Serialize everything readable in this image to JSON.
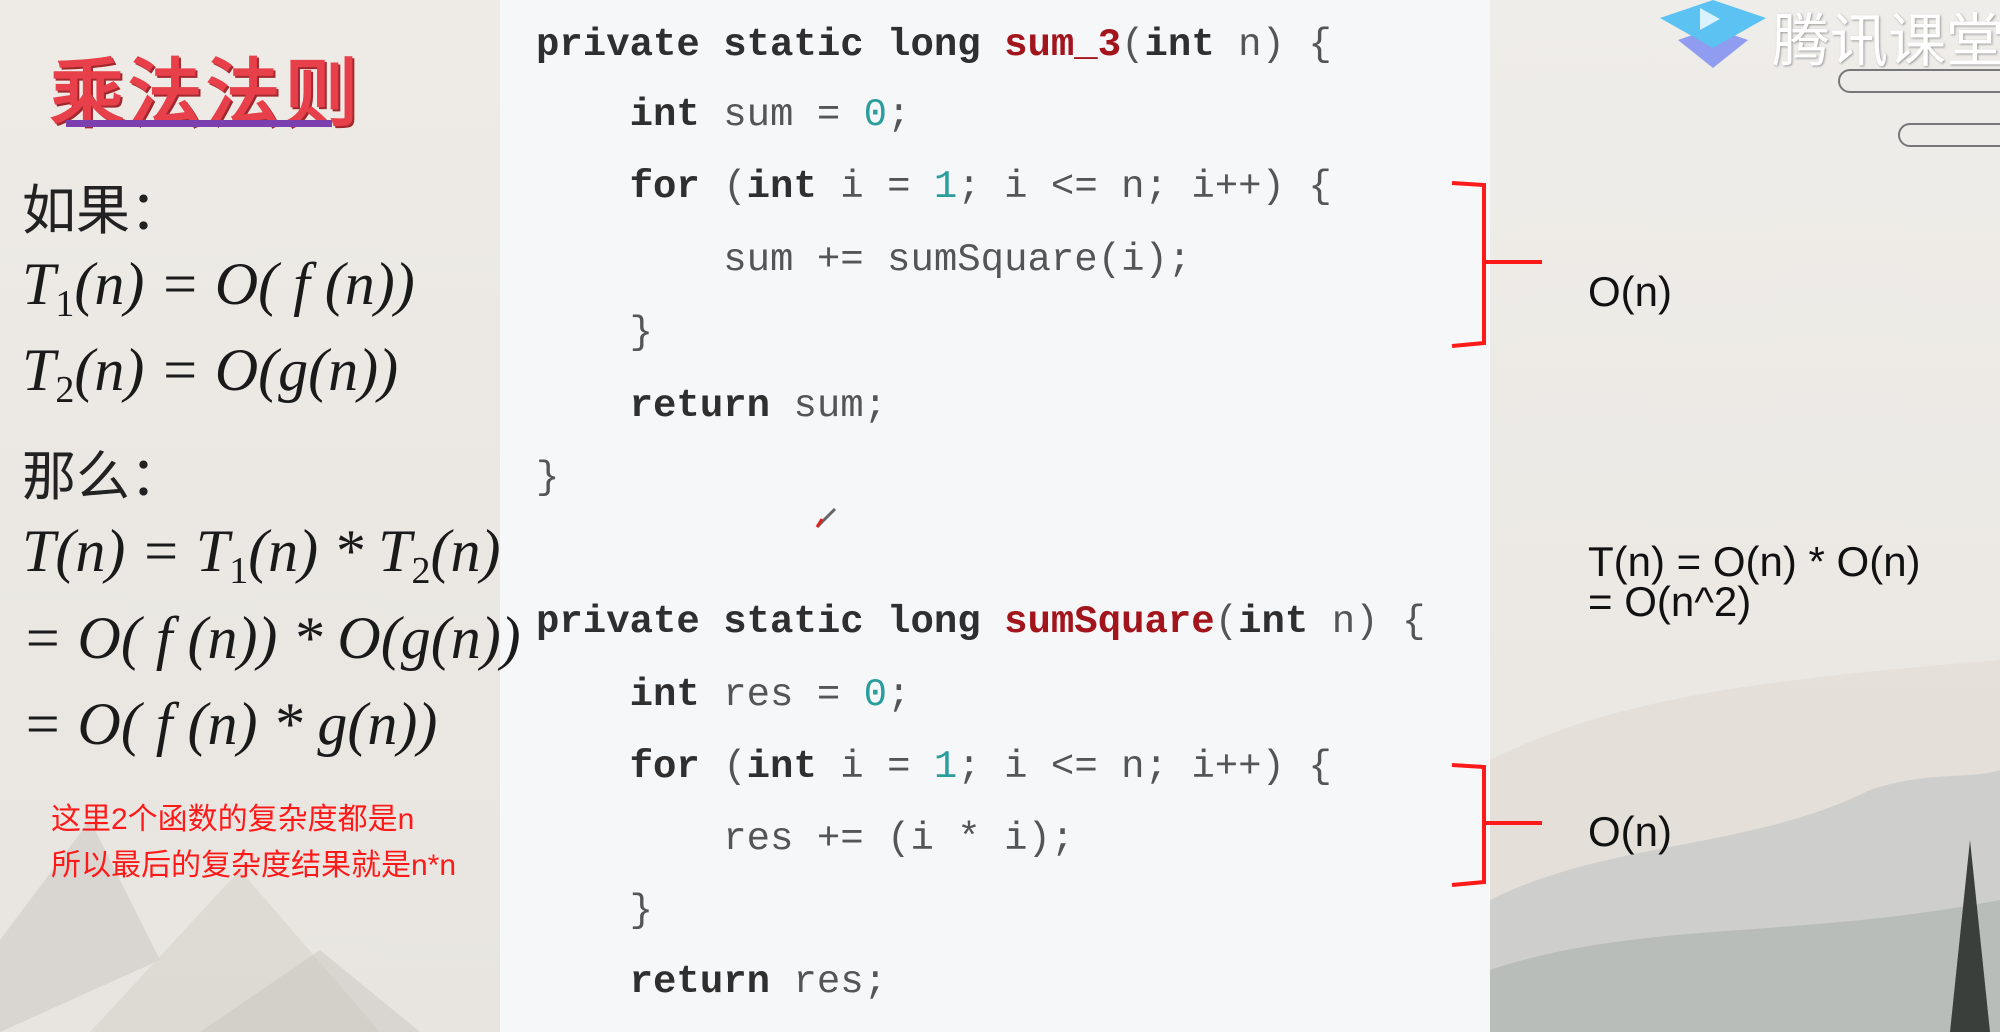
{
  "slide": {
    "title": "乘法法则",
    "if_label": "如果：",
    "then_label": "那么：",
    "math_lines": [
      [
        {
          "t": "T"
        },
        {
          "sub": "1"
        },
        {
          "t": "(n) = O( f (n))"
        }
      ],
      [
        {
          "t": "T"
        },
        {
          "sub": "2"
        },
        {
          "t": "(n) = O(g(n))"
        }
      ],
      [
        {
          "t": "T(n) = T"
        },
        {
          "sub": "1"
        },
        {
          "t": "(n) * T"
        },
        {
          "sub": "2"
        },
        {
          "t": "(n)"
        }
      ],
      [
        {
          "t": "= O( f (n)) * O(g(n))"
        }
      ],
      [
        {
          "t": "= O( f (n) * g(n))"
        }
      ]
    ],
    "note_lines": [
      "这里2个函数的复杂度都是n",
      "所以最后的复杂度结果就是n*n"
    ]
  },
  "code": [
    [
      {
        "t": "private static long ",
        "c": "kw"
      },
      {
        "t": "sum_3",
        "c": "fn"
      },
      {
        "t": "(",
        "c": ""
      },
      {
        "t": "int",
        "c": "kw"
      },
      {
        "t": " n) {",
        "c": ""
      }
    ],
    [
      {
        "t": "    "
      },
      {
        "t": "int",
        "c": "kw"
      },
      {
        "t": " sum = "
      },
      {
        "t": "0",
        "c": "num"
      },
      {
        "t": ";"
      }
    ],
    [
      {
        "t": "    "
      },
      {
        "t": "for",
        "c": "kw"
      },
      {
        "t": " ("
      },
      {
        "t": "int",
        "c": "kw"
      },
      {
        "t": " i = "
      },
      {
        "t": "1",
        "c": "num"
      },
      {
        "t": "; i <= n; i++) {"
      }
    ],
    [
      {
        "t": "        sum += sumSquare(i);"
      }
    ],
    [
      {
        "t": "    }"
      }
    ],
    [
      {
        "t": "    "
      },
      {
        "t": "return",
        "c": "kw"
      },
      {
        "t": " sum;"
      }
    ],
    [
      {
        "t": "}"
      }
    ],
    [
      {
        "t": "private static long ",
        "c": "kw"
      },
      {
        "t": "sumSquare",
        "c": "fn"
      },
      {
        "t": "("
      },
      {
        "t": "int",
        "c": "kw"
      },
      {
        "t": " n) {"
      }
    ],
    [
      {
        "t": "    "
      },
      {
        "t": "int",
        "c": "kw"
      },
      {
        "t": " res = "
      },
      {
        "t": "0",
        "c": "num"
      },
      {
        "t": ";"
      }
    ],
    [
      {
        "t": "    "
      },
      {
        "t": "for",
        "c": "kw"
      },
      {
        "t": " ("
      },
      {
        "t": "int",
        "c": "kw"
      },
      {
        "t": " i = "
      },
      {
        "t": "1",
        "c": "num"
      },
      {
        "t": "; i <= n; i++) {"
      }
    ],
    [
      {
        "t": "        res += (i * i);"
      }
    ],
    [
      {
        "t": "    }"
      }
    ],
    [
      {
        "t": "    "
      },
      {
        "t": "return",
        "c": "kw"
      },
      {
        "t": " res;"
      }
    ]
  ],
  "annotations": {
    "loop1": "O(n)",
    "loop2": "O(n)",
    "total_line1": "T(n) = O(n) * O(n)",
    "total_line2": "= O(n^2)"
  },
  "logo": {
    "text": "腾讯课堂",
    "icon": "play-cap-icon"
  },
  "colors": {
    "accent_red": "#e8404a",
    "underline": "#7b3fb0",
    "note": "#ff1a1a",
    "brace": "#ff1a1a"
  }
}
